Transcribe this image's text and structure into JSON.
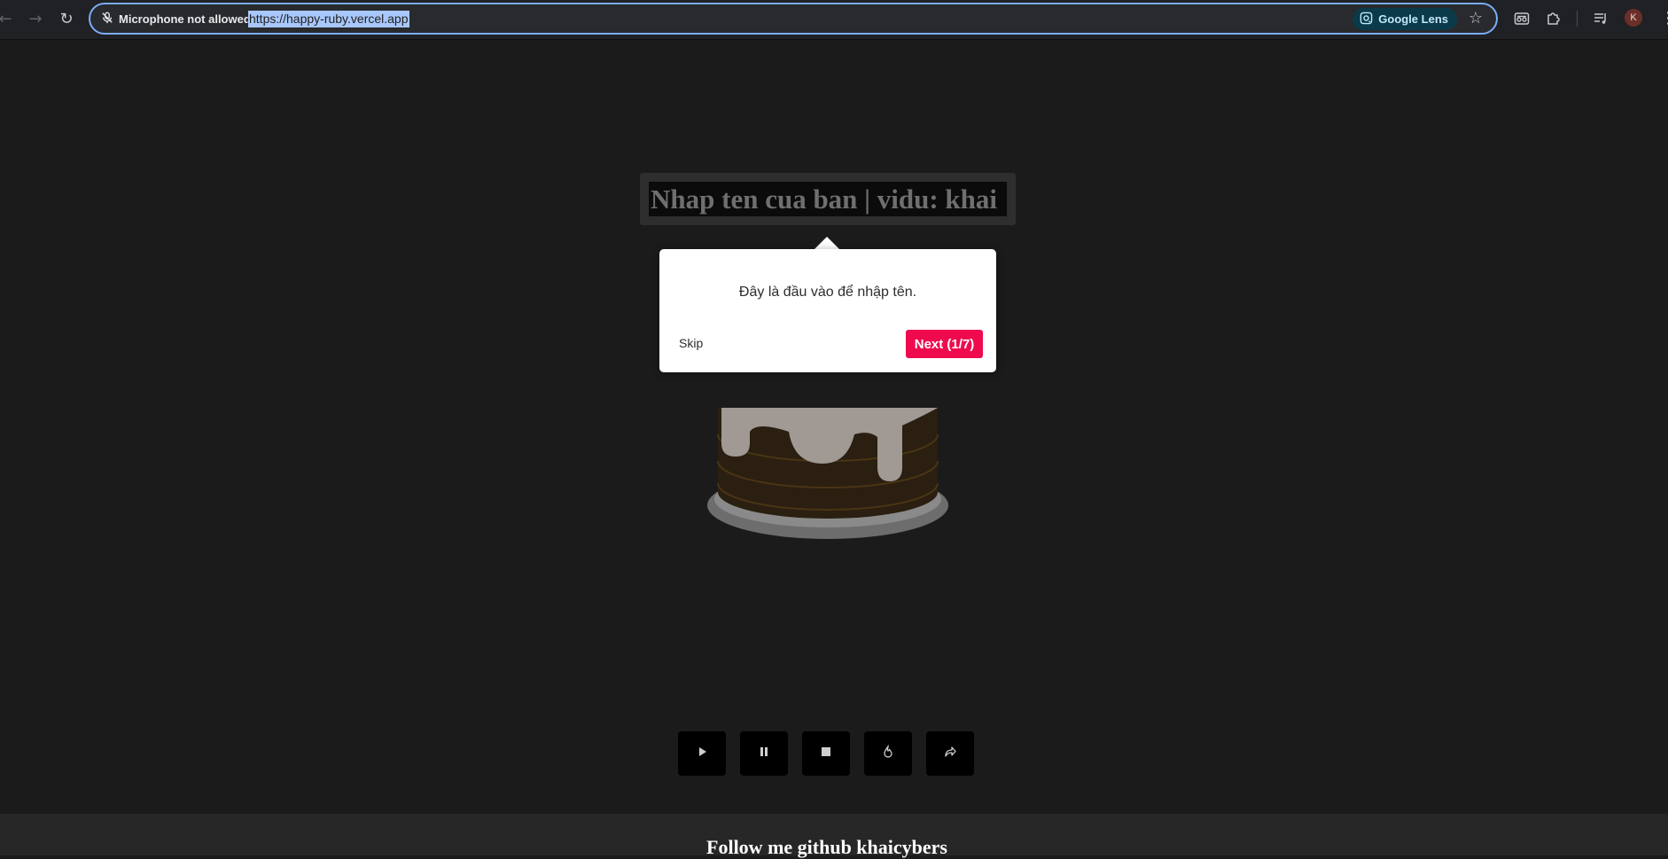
{
  "browser": {
    "mic_status": "Microphone not allowed",
    "url": "https://happy-ruby.vercel.app",
    "lens_label": "Google Lens",
    "profile_initial": "K",
    "icons": [
      "back-arrow-icon",
      "forward-arrow-icon",
      "reload-icon",
      "mic-off-icon",
      "google-lens-icon",
      "bookmark-star-icon",
      "incognito-icon",
      "extensions-icon",
      "media-queue-icon",
      "kebab-menu-icon"
    ]
  },
  "page": {
    "name_input": {
      "placeholder": "Nhap ten cua ban | vidu: khai"
    },
    "tour": {
      "message": "Đây là đầu vào để nhập tên.",
      "skip_label": "Skip",
      "next_label": "Next (1/7)",
      "next_color": "#ef0a4d"
    },
    "controls": [
      {
        "name": "play-button",
        "icon": "play-icon"
      },
      {
        "name": "pause-button",
        "icon": "pause-icon"
      },
      {
        "name": "stop-button",
        "icon": "stop-icon"
      },
      {
        "name": "candle-button",
        "icon": "flame-icon"
      },
      {
        "name": "share-button",
        "icon": "share-icon"
      }
    ],
    "footer_text": "Follow me github khaicybers"
  }
}
